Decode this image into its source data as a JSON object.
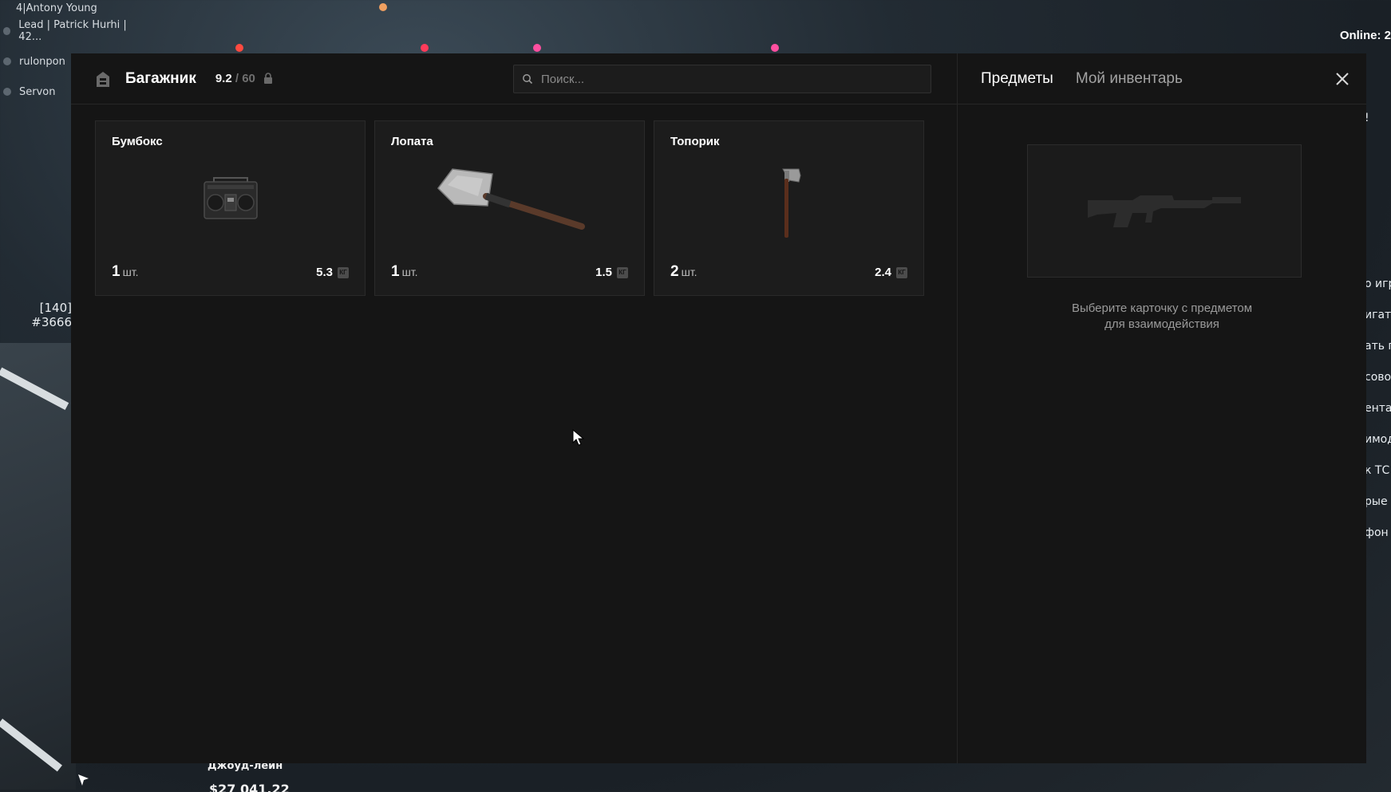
{
  "hud": {
    "players": [
      {
        "name": "4|Antony Young"
      },
      {
        "name": "Lead | Patrick Hurhi | 42..."
      },
      {
        "name": "rulonpon"
      },
      {
        "name": "Servon"
      }
    ],
    "online_label": "Online: 2",
    "left_ids": [
      "[140]",
      "#3666"
    ],
    "right_snippets": [
      "!",
      "о игр",
      "игато",
      "ать п",
      "сово",
      "ента",
      "имод",
      "к ТС",
      "рые",
      "фон"
    ],
    "street": "Джоуд-лейн",
    "money": "$27 041.22"
  },
  "trunk": {
    "title": "Багажник",
    "weight_current": "9.2",
    "weight_sep": " / ",
    "weight_max": "60",
    "search_placeholder": "Поиск..."
  },
  "items": [
    {
      "name": "Бумбокс",
      "qty": "1",
      "unit": "шт.",
      "weight": "5.3",
      "icon": "boombox-icon"
    },
    {
      "name": "Лопата",
      "qty": "1",
      "unit": "шт.",
      "weight": "1.5",
      "icon": "shovel-icon"
    },
    {
      "name": "Топорик",
      "qty": "2",
      "unit": "шт.",
      "weight": "2.4",
      "icon": "hatchet-icon"
    }
  ],
  "kg_label": "КГ",
  "tabs": {
    "items": "Предметы",
    "my_inventory": "Мой инвентарь"
  },
  "hint": {
    "line1": "Выберите карточку с предметом",
    "line2": "для взаимодействия"
  }
}
